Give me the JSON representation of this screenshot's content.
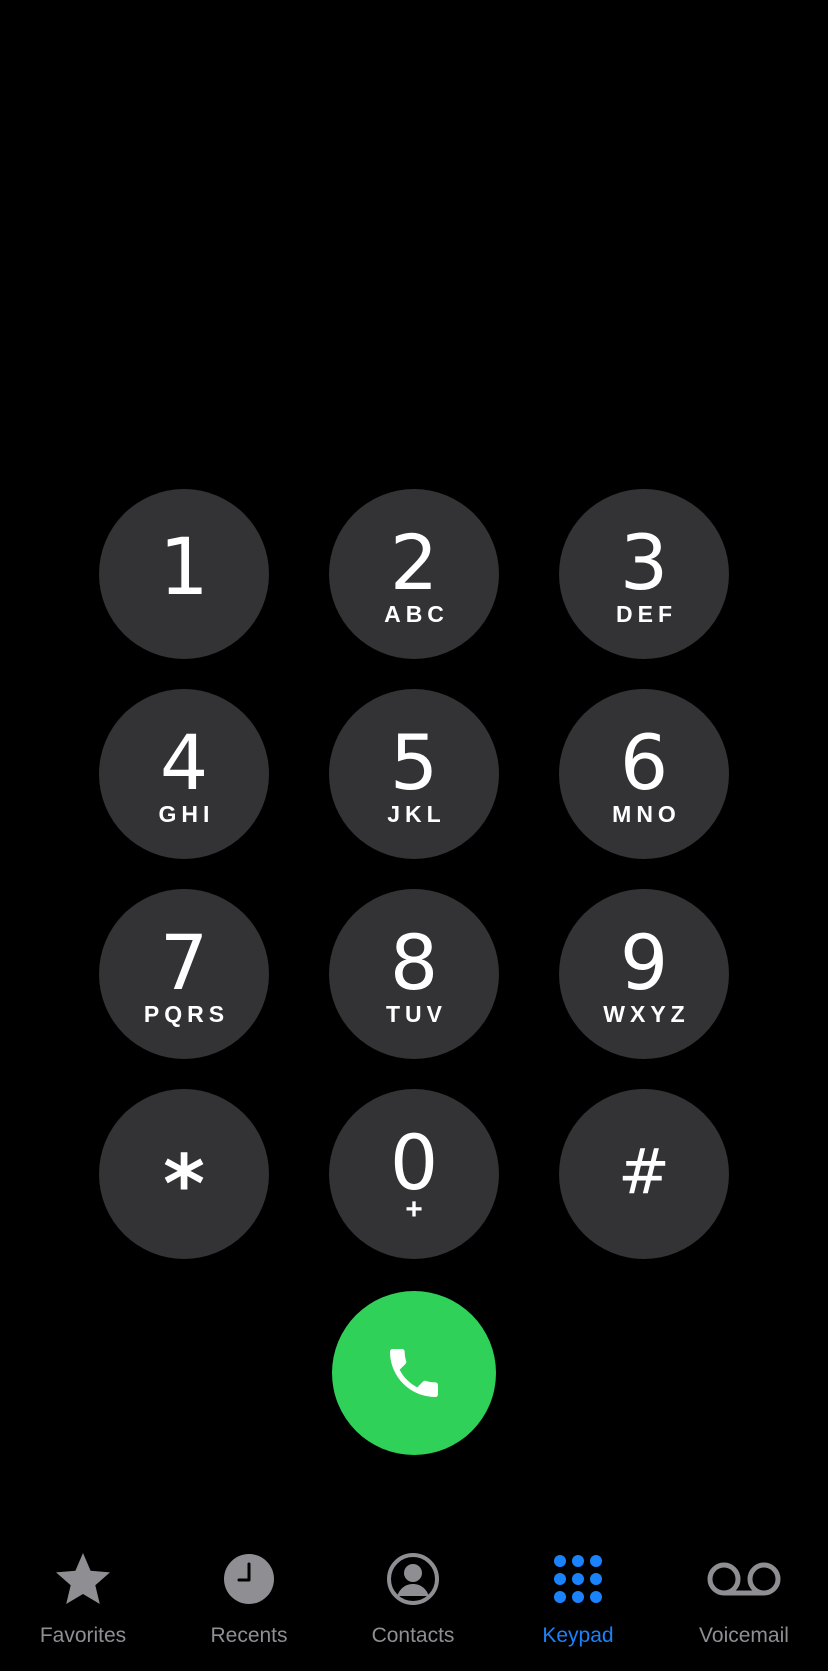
{
  "keypad": {
    "keys": [
      {
        "digit": "1",
        "letters": ""
      },
      {
        "digit": "2",
        "letters": "ABC"
      },
      {
        "digit": "3",
        "letters": "DEF"
      },
      {
        "digit": "4",
        "letters": "GHI"
      },
      {
        "digit": "5",
        "letters": "JKL"
      },
      {
        "digit": "6",
        "letters": "MNO"
      },
      {
        "digit": "7",
        "letters": "PQRS"
      },
      {
        "digit": "8",
        "letters": "TUV"
      },
      {
        "digit": "9",
        "letters": "WXYZ"
      },
      {
        "digit": "*",
        "letters": ""
      },
      {
        "digit": "0",
        "letters": "+"
      },
      {
        "digit": "#",
        "letters": ""
      }
    ]
  },
  "call_button": {
    "icon": "phone-icon",
    "color": "#30d158"
  },
  "tabbar": {
    "tabs": [
      {
        "label": "Favorites",
        "icon": "star-icon",
        "active": false
      },
      {
        "label": "Recents",
        "icon": "clock-icon",
        "active": false
      },
      {
        "label": "Contacts",
        "icon": "person-circle-icon",
        "active": false
      },
      {
        "label": "Keypad",
        "icon": "keypad-grid-icon",
        "active": true
      },
      {
        "label": "Voicemail",
        "icon": "voicemail-icon",
        "active": false
      }
    ],
    "active_color": "#1a82fb",
    "inactive_color": "#8e8e93"
  },
  "colors": {
    "background": "#000000",
    "key_background": "#333335"
  }
}
